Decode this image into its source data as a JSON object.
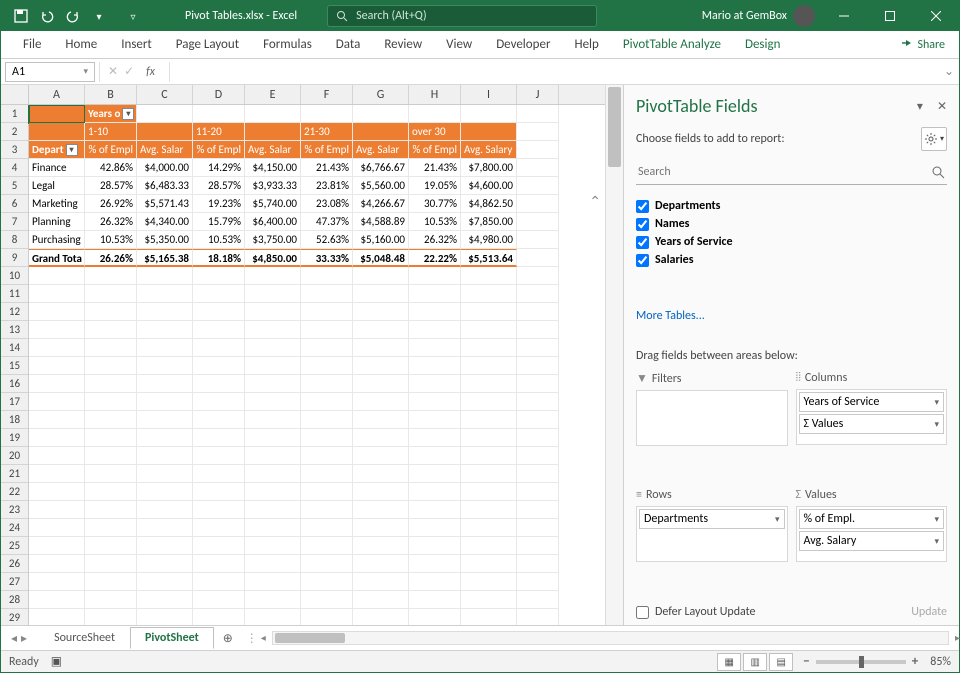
{
  "titlebar": {
    "filename": "Pivot Tables.xlsx  -  Excel",
    "search_placeholder": "Search (Alt+Q)",
    "user": "Mario at GemBox"
  },
  "ribbon": {
    "tabs": [
      "File",
      "Home",
      "Insert",
      "Page Layout",
      "Formulas",
      "Data",
      "Review",
      "View",
      "Developer",
      "Help",
      "PivotTable Analyze",
      "Design"
    ],
    "share": "Share"
  },
  "formula": {
    "cell_ref": "A1"
  },
  "grid": {
    "col_letters": [
      "A",
      "B",
      "C",
      "D",
      "E",
      "F",
      "G",
      "H",
      "I",
      "J"
    ],
    "row_count": 29,
    "years_label": "Years o",
    "ranges": [
      "1-10",
      "11-20",
      "21-30",
      "over 30"
    ],
    "hdr_dept": "Depart",
    "hdr_pair": [
      "% of Empl",
      "Avg. Salar"
    ],
    "hdr_pair_last": [
      "% of Empl",
      "Avg. Salary"
    ],
    "rows": [
      {
        "dept": "Finance",
        "v": [
          "42.86%",
          "$4,000.00",
          "14.29%",
          "$4,150.00",
          "21.43%",
          "$6,766.67",
          "21.43%",
          "$7,800.00"
        ]
      },
      {
        "dept": "Legal",
        "v": [
          "28.57%",
          "$6,483.33",
          "28.57%",
          "$3,933.33",
          "23.81%",
          "$5,560.00",
          "19.05%",
          "$4,600.00"
        ]
      },
      {
        "dept": "Marketing",
        "v": [
          "26.92%",
          "$5,571.43",
          "19.23%",
          "$5,740.00",
          "23.08%",
          "$4,266.67",
          "30.77%",
          "$4,862.50"
        ]
      },
      {
        "dept": "Planning",
        "v": [
          "26.32%",
          "$4,340.00",
          "15.79%",
          "$6,400.00",
          "47.37%",
          "$4,588.89",
          "10.53%",
          "$7,850.00"
        ]
      },
      {
        "dept": "Purchasing",
        "v": [
          "10.53%",
          "$5,350.00",
          "10.53%",
          "$3,750.00",
          "52.63%",
          "$5,160.00",
          "26.32%",
          "$4,980.00"
        ]
      }
    ],
    "grand": {
      "label": "Grand Tota",
      "v": [
        "26.26%",
        "$5,165.38",
        "18.18%",
        "$4,850.00",
        "33.33%",
        "$5,048.48",
        "22.22%",
        "$5,513.64"
      ]
    }
  },
  "pane": {
    "title": "PivotTable Fields",
    "subtitle": "Choose fields to add to report:",
    "search_placeholder": "Search",
    "fields": [
      {
        "label": "Departments",
        "checked": true,
        "bold": true
      },
      {
        "label": "Names",
        "checked": true,
        "bold": true
      },
      {
        "label": "Years of Service",
        "checked": true,
        "bold": true
      },
      {
        "label": "Salaries",
        "checked": true,
        "bold": true
      }
    ],
    "more": "More Tables...",
    "drag_label": "Drag fields between areas below:",
    "quads": {
      "filters": {
        "title": "Filters",
        "items": []
      },
      "columns": {
        "title": "Columns",
        "items": [
          "Years of Service",
          "Σ  Values"
        ]
      },
      "rows": {
        "title": "Rows",
        "items": [
          "Departments"
        ]
      },
      "values": {
        "title": "Values",
        "sigma": "Σ",
        "items": [
          "% of Empl.",
          "Avg. Salary"
        ]
      }
    },
    "defer": "Defer Layout Update",
    "update": "Update"
  },
  "tabs": {
    "sheets": [
      "SourceSheet",
      "PivotSheet"
    ],
    "active": 1
  },
  "status": {
    "ready": "Ready",
    "zoom": "85%"
  },
  "chart_data": {
    "type": "table",
    "title": "PivotTable: % of Employees and Avg. Salary by Department and Years of Service",
    "row_field": "Departments",
    "column_field": "Years of Service",
    "column_categories": [
      "1-10",
      "11-20",
      "21-30",
      "over 30"
    ],
    "measures": [
      "% of Empl.",
      "Avg. Salary"
    ],
    "data": [
      {
        "department": "Finance",
        "1-10": {
          "pct": 42.86,
          "avg": 4000.0
        },
        "11-20": {
          "pct": 14.29,
          "avg": 4150.0
        },
        "21-30": {
          "pct": 21.43,
          "avg": 6766.67
        },
        "over 30": {
          "pct": 21.43,
          "avg": 7800.0
        }
      },
      {
        "department": "Legal",
        "1-10": {
          "pct": 28.57,
          "avg": 6483.33
        },
        "11-20": {
          "pct": 28.57,
          "avg": 3933.33
        },
        "21-30": {
          "pct": 23.81,
          "avg": 5560.0
        },
        "over 30": {
          "pct": 19.05,
          "avg": 4600.0
        }
      },
      {
        "department": "Marketing",
        "1-10": {
          "pct": 26.92,
          "avg": 5571.43
        },
        "11-20": {
          "pct": 19.23,
          "avg": 5740.0
        },
        "21-30": {
          "pct": 23.08,
          "avg": 4266.67
        },
        "over 30": {
          "pct": 30.77,
          "avg": 4862.5
        }
      },
      {
        "department": "Planning",
        "1-10": {
          "pct": 26.32,
          "avg": 4340.0
        },
        "11-20": {
          "pct": 15.79,
          "avg": 6400.0
        },
        "21-30": {
          "pct": 47.37,
          "avg": 4588.89
        },
        "over 30": {
          "pct": 10.53,
          "avg": 7850.0
        }
      },
      {
        "department": "Purchasing",
        "1-10": {
          "pct": 10.53,
          "avg": 5350.0
        },
        "11-20": {
          "pct": 10.53,
          "avg": 3750.0
        },
        "21-30": {
          "pct": 52.63,
          "avg": 5160.0
        },
        "over 30": {
          "pct": 26.32,
          "avg": 4980.0
        }
      }
    ],
    "grand_total": {
      "1-10": {
        "pct": 26.26,
        "avg": 5165.38
      },
      "11-20": {
        "pct": 18.18,
        "avg": 4850.0
      },
      "21-30": {
        "pct": 33.33,
        "avg": 5048.48
      },
      "over 30": {
        "pct": 22.22,
        "avg": 5513.64
      }
    }
  }
}
